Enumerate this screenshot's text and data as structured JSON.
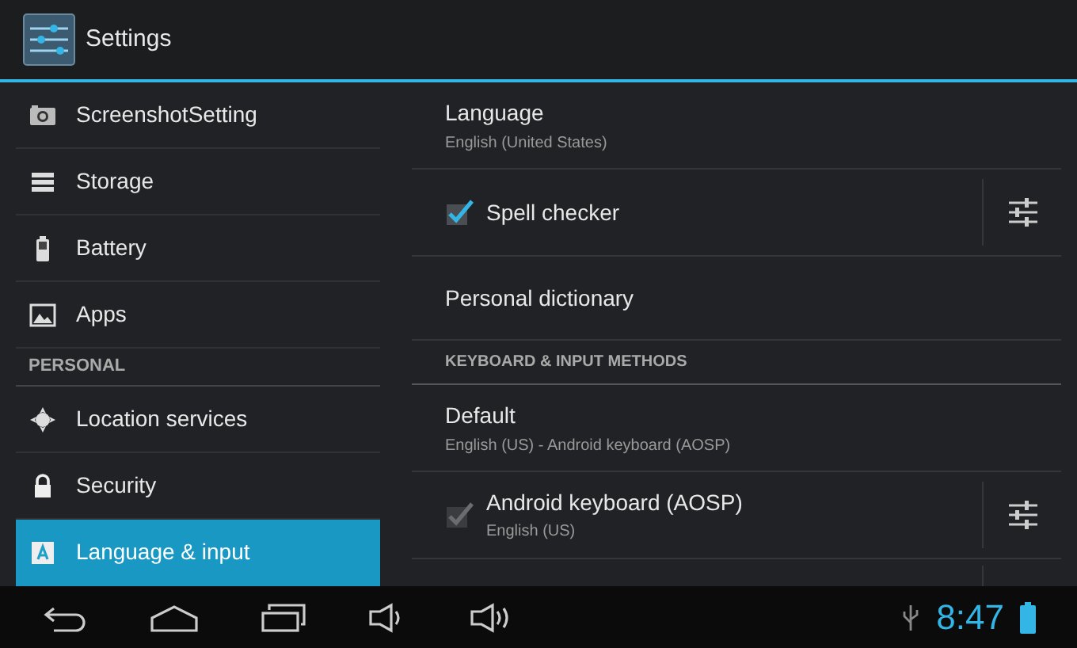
{
  "action_bar": {
    "title": "Settings"
  },
  "sidebar": {
    "items": [
      {
        "kind": "item",
        "label": "ScreenshotSetting",
        "selected": false
      },
      {
        "kind": "item",
        "label": "Storage",
        "selected": false
      },
      {
        "kind": "item",
        "label": "Battery",
        "selected": false
      },
      {
        "kind": "item",
        "label": "Apps",
        "selected": false
      },
      {
        "kind": "header",
        "label": "PERSONAL"
      },
      {
        "kind": "item",
        "label": "Location services",
        "selected": false
      },
      {
        "kind": "item",
        "label": "Security",
        "selected": false
      },
      {
        "kind": "item",
        "label": "Language & input",
        "selected": true
      }
    ]
  },
  "preferences": [
    {
      "kind": "text",
      "title": "Language",
      "summary": "English (United States)"
    },
    {
      "kind": "check",
      "title": "Spell checker",
      "checked": true,
      "disabled": false
    },
    {
      "kind": "text",
      "title": "Personal dictionary"
    },
    {
      "kind": "header",
      "title": "KEYBOARD & INPUT METHODS"
    },
    {
      "kind": "text",
      "title": "Default",
      "summary": "English (US) - Android keyboard (AOSP)"
    },
    {
      "kind": "check",
      "title": "Android keyboard (AOSP)",
      "summary": "English (US)",
      "checked": true,
      "disabled": true
    },
    {
      "kind": "partial"
    }
  ],
  "status_bar": {
    "time": "8:47"
  }
}
